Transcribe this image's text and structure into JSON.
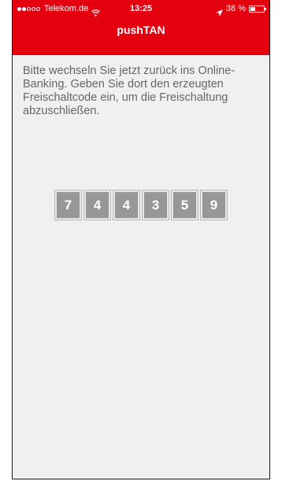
{
  "status_bar": {
    "signal_dots_filled": 2,
    "signal_dots_total": 5,
    "carrier": "Telekom.de",
    "time": "13:25",
    "battery_text": "38 %",
    "battery_level": 0.38
  },
  "nav": {
    "title": "pushTAN"
  },
  "main": {
    "message": "Bitte wechseln Sie jetzt zurück ins Online-Banking. Geben Sie dort den erzeugten Freischaltcode ein, um die Freischaltung abzuschließen.",
    "code_digits": [
      "7",
      "4",
      "4",
      "3",
      "5",
      "9"
    ]
  },
  "colors": {
    "header_red": "#e4000f",
    "background": "#f0f0f0",
    "text_gray": "#666666",
    "digit_box": "#979797"
  },
  "icons": [
    "wifi-icon",
    "location-icon",
    "battery-icon"
  ]
}
